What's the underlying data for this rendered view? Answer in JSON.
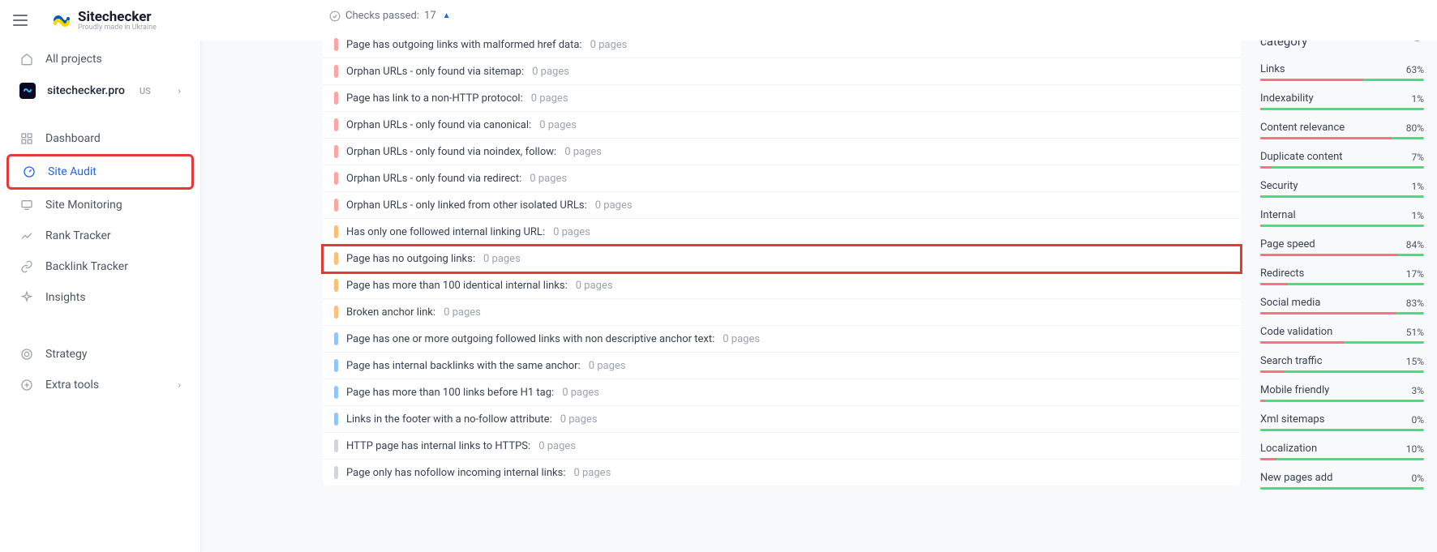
{
  "header": {
    "brand": "Sitechecker",
    "tagline": "Proudly made in Ukraine"
  },
  "sidebar": {
    "all_projects": "All projects",
    "project_name": "sitechecker.pro",
    "project_region": "US",
    "items": {
      "dashboard": "Dashboard",
      "site_audit": "Site Audit",
      "site_monitoring": "Site Monitoring",
      "rank_tracker": "Rank Tracker",
      "backlink_tracker": "Backlink Tracker",
      "insights": "Insights",
      "strategy": "Strategy",
      "extra_tools": "Extra tools"
    }
  },
  "checks_passed": {
    "label": "Checks passed:",
    "count": "17"
  },
  "checks": [
    {
      "sev": "red",
      "label": "Page has outgoing links with malformed href data",
      "pages": "0 pages",
      "hl": false
    },
    {
      "sev": "red",
      "label": "Orphan URLs - only found via sitemap",
      "pages": "0 pages",
      "hl": false
    },
    {
      "sev": "red",
      "label": "Page has link to a non-HTTP protocol",
      "pages": "0 pages",
      "hl": false
    },
    {
      "sev": "red",
      "label": "Orphan URLs - only found via canonical",
      "pages": "0 pages",
      "hl": false
    },
    {
      "sev": "red",
      "label": "Orphan URLs - only found via noindex, follow",
      "pages": "0 pages",
      "hl": false
    },
    {
      "sev": "red",
      "label": "Orphan URLs - only found via redirect",
      "pages": "0 pages",
      "hl": false
    },
    {
      "sev": "red",
      "label": "Orphan URLs - only linked from other isolated URLs",
      "pages": "0 pages",
      "hl": false
    },
    {
      "sev": "orange",
      "label": "Has only one followed internal linking URL",
      "pages": "0 pages",
      "hl": false
    },
    {
      "sev": "orange",
      "label": "Page has no outgoing links",
      "pages": "0 pages",
      "hl": true
    },
    {
      "sev": "orange",
      "label": "Page has more than 100 identical internal links",
      "pages": "0 pages",
      "hl": false
    },
    {
      "sev": "orange",
      "label": "Broken anchor link",
      "pages": "0 pages",
      "hl": false
    },
    {
      "sev": "blue",
      "label": "Page has one or more outgoing followed links with non descriptive anchor text",
      "pages": "0 pages",
      "hl": false
    },
    {
      "sev": "blue",
      "label": "Page has internal backlinks with the same anchor",
      "pages": "0 pages",
      "hl": false
    },
    {
      "sev": "blue",
      "label": "Page has more than 100 links before H1 tag",
      "pages": "0 pages",
      "hl": false
    },
    {
      "sev": "blue",
      "label": "Links in the footer with a no-follow attribute",
      "pages": "0 pages",
      "hl": false
    },
    {
      "sev": "gray",
      "label": "HTTP page has internal links to HTTPS",
      "pages": "0 pages",
      "hl": false
    },
    {
      "sev": "gray",
      "label": "Page only has nofollow incoming internal links",
      "pages": "0 pages",
      "hl": false
    }
  ],
  "categories_title": "Affected pages by category",
  "categories": [
    {
      "name": "Links",
      "pct": "63%",
      "red": 63
    },
    {
      "name": "Indexability",
      "pct": "1%",
      "red": 1
    },
    {
      "name": "Content relevance",
      "pct": "80%",
      "red": 80
    },
    {
      "name": "Duplicate content",
      "pct": "7%",
      "red": 7
    },
    {
      "name": "Security",
      "pct": "1%",
      "red": 1
    },
    {
      "name": "Internal",
      "pct": "1%",
      "red": 1
    },
    {
      "name": "Page speed",
      "pct": "84%",
      "red": 84
    },
    {
      "name": "Redirects",
      "pct": "17%",
      "red": 17
    },
    {
      "name": "Social media",
      "pct": "83%",
      "red": 83
    },
    {
      "name": "Code validation",
      "pct": "51%",
      "red": 51
    },
    {
      "name": "Search traffic",
      "pct": "15%",
      "red": 15
    },
    {
      "name": "Mobile friendly",
      "pct": "3%",
      "red": 3
    },
    {
      "name": "Xml sitemaps",
      "pct": "0%",
      "red": 0
    },
    {
      "name": "Localization",
      "pct": "10%",
      "red": 10
    },
    {
      "name": "New pages add",
      "pct": "0%",
      "red": 0
    }
  ]
}
